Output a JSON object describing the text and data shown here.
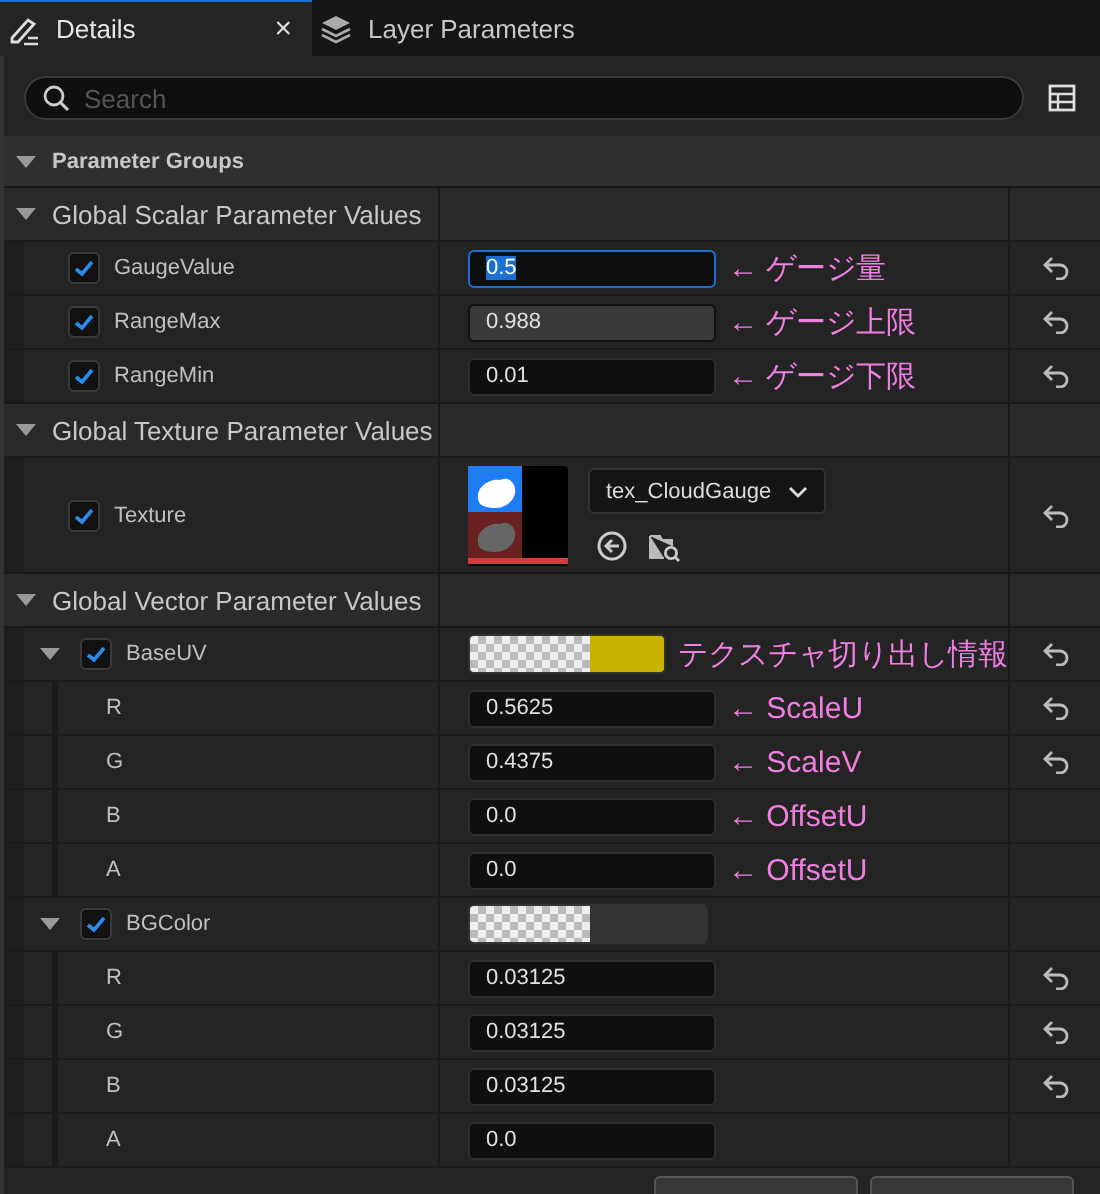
{
  "tabs": [
    {
      "label": "Details",
      "selected": true,
      "close": "×"
    },
    {
      "label": "Layer Parameters",
      "selected": false
    }
  ],
  "search": {
    "placeholder": "Search"
  },
  "header": {
    "title": "Parameter Groups",
    "expanded": true
  },
  "groups": [
    {
      "title": "Global Scalar Parameter Values",
      "expanded": true,
      "params": [
        {
          "kind": "scalar",
          "name": "GaugeValue",
          "checked": true,
          "value": "0.5",
          "focused": true,
          "hovered": false,
          "note": "← ゲージ量",
          "resettable": true
        },
        {
          "kind": "scalar",
          "name": "RangeMax",
          "checked": true,
          "value": "0.988",
          "focused": false,
          "hovered": true,
          "note": "← ゲージ上限",
          "resettable": true
        },
        {
          "kind": "scalar",
          "name": "RangeMin",
          "checked": true,
          "value": "0.01",
          "focused": false,
          "hovered": false,
          "note": "← ゲージ下限",
          "resettable": true
        }
      ]
    },
    {
      "title": "Global Texture Parameter Values",
      "expanded": true,
      "params": [
        {
          "kind": "texture",
          "name": "Texture",
          "checked": true,
          "asset": "tex_CloudGauge",
          "resettable": true
        }
      ]
    },
    {
      "title": "Global Vector Parameter Values",
      "expanded": true,
      "params": [
        {
          "kind": "vector",
          "name": "BaseUV",
          "checked": true,
          "expanded": true,
          "color": "#c8b400",
          "note": "テクスチャ切り出し情報",
          "resettable": true,
          "children": [
            {
              "name": "R",
              "value": "0.5625",
              "note": "← ScaleU",
              "resettable": true
            },
            {
              "name": "G",
              "value": "0.4375",
              "note": "← ScaleV",
              "resettable": true
            },
            {
              "name": "B",
              "value": "0.0",
              "note": "← OffsetU",
              "resettable": false
            },
            {
              "name": "A",
              "value": "0.0",
              "note": "← OffsetU",
              "resettable": false
            }
          ]
        },
        {
          "kind": "vector",
          "name": "BGColor",
          "checked": true,
          "expanded": true,
          "color": "#333333",
          "resettable": false,
          "children": [
            {
              "name": "R",
              "value": "0.03125",
              "resettable": true
            },
            {
              "name": "G",
              "value": "0.03125",
              "resettable": true
            },
            {
              "name": "B",
              "value": "0.03125",
              "resettable": true
            },
            {
              "name": "A",
              "value": "0.0",
              "resettable": false
            }
          ]
        }
      ]
    }
  ]
}
